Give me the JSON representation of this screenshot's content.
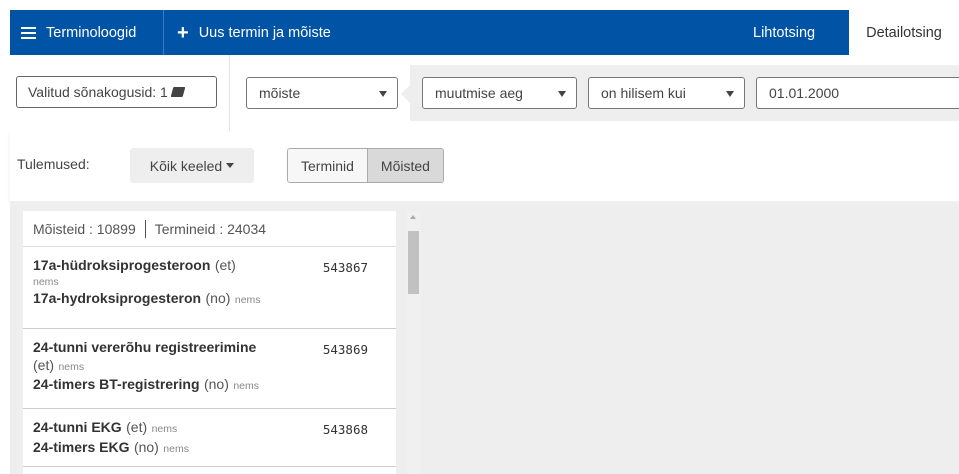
{
  "topbar": {
    "terminology_label": "Terminoloogid",
    "new_term_label": "Uus termin ja mõiste",
    "simple_search_label": "Lihtotsing",
    "detail_search_label": "Detailotsing"
  },
  "filter": {
    "dictionaries_label": "Valitud sõnakogusid: 1",
    "entity_select": "mõiste",
    "field_select": "muutmise aeg",
    "operator_select": "on hilisem kui",
    "date_value": "01.01.2000"
  },
  "results": {
    "label": "Tulemused:",
    "languages_button": "Kõik keeled",
    "terms_toggle": "Terminid",
    "concepts_toggle": "Mõisted"
  },
  "list": {
    "concepts_count": "Mõisteid : 10899",
    "terms_count": "Termineid : 24034",
    "items": [
      {
        "id": "543867",
        "term1": "17a-hüdroksiprogesteroon",
        "lang1": "(et)",
        "src1": "nems",
        "term2": "17a-hydroksiprogesteron",
        "lang2": "(no)",
        "src2": "nems"
      },
      {
        "id": "543869",
        "term1": "24-tunni vererõhu registreerimine",
        "lang1": "(et)",
        "src1": "nems",
        "term2": "24-timers BT-registrering",
        "lang2": "(no)",
        "src2": "nems"
      },
      {
        "id": "543868",
        "term1": "24-tunni EKG",
        "lang1": "(et)",
        "src1": "nems",
        "term2": "24-timers EKG",
        "lang2": "(no)",
        "src2": "nems"
      }
    ]
  },
  "icons": {
    "menu": "hamburger-icon",
    "add": "plus-icon",
    "book": "book-icon",
    "dropdown": "caret-down-icon"
  },
  "colors": {
    "topbar_bg": "#0153a5",
    "panel_bg": "#eeeeee",
    "toggle_active_bg": "#d9d9d9"
  }
}
